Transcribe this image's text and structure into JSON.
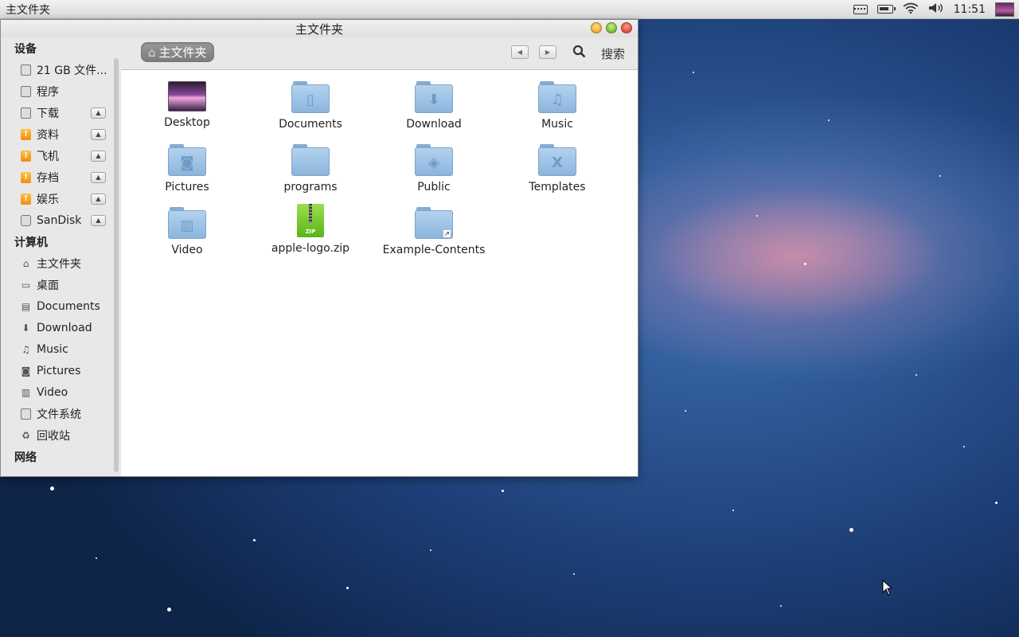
{
  "topbar": {
    "app_title": "主文件夹",
    "clock": "11:51",
    "icons": [
      "keyboard-icon",
      "battery-icon",
      "wifi-icon",
      "volume-icon",
      "user-avatar"
    ]
  },
  "window": {
    "title": "主文件夹",
    "buttons": [
      "minimize",
      "maximize",
      "close"
    ]
  },
  "sidebar": {
    "devices_header": "设备",
    "devices": [
      {
        "label": "21 GB 文件...",
        "icon": "drive-icon",
        "eject": false
      },
      {
        "label": "程序",
        "icon": "drive-icon",
        "eject": false
      },
      {
        "label": "下载",
        "icon": "drive-icon",
        "eject": true
      },
      {
        "label": "资料",
        "icon": "orange-drive-icon",
        "eject": true
      },
      {
        "label": "飞机",
        "icon": "orange-drive-icon",
        "eject": true
      },
      {
        "label": "存档",
        "icon": "orange-drive-icon",
        "eject": true
      },
      {
        "label": "娱乐",
        "icon": "orange-drive-icon",
        "eject": true
      },
      {
        "label": "SanDisk",
        "icon": "usb-drive-icon",
        "eject": true
      }
    ],
    "computer_header": "计算机",
    "computer": [
      {
        "label": "主文件夹",
        "icon": "home-icon"
      },
      {
        "label": "桌面",
        "icon": "desktop-icon"
      },
      {
        "label": "Documents",
        "icon": "documents-icon"
      },
      {
        "label": "Download",
        "icon": "download-icon"
      },
      {
        "label": "Music",
        "icon": "music-icon"
      },
      {
        "label": "Pictures",
        "icon": "camera-icon"
      },
      {
        "label": "Video",
        "icon": "film-icon"
      },
      {
        "label": "文件系统",
        "icon": "drive-icon"
      },
      {
        "label": "回收站",
        "icon": "trash-icon"
      }
    ],
    "network_header": "网络"
  },
  "toolbar": {
    "breadcrumb": "主文件夹",
    "search_label": "搜索"
  },
  "files": [
    {
      "name": "Desktop",
      "kind": "desktop-thumb"
    },
    {
      "name": "Documents",
      "kind": "folder",
      "emblem": "document"
    },
    {
      "name": "Download",
      "kind": "folder",
      "emblem": "download"
    },
    {
      "name": "Music",
      "kind": "folder",
      "emblem": "music"
    },
    {
      "name": "Pictures",
      "kind": "folder",
      "emblem": "camera"
    },
    {
      "name": "programs",
      "kind": "folder",
      "emblem": ""
    },
    {
      "name": "Public",
      "kind": "folder",
      "emblem": "public"
    },
    {
      "name": "Templates",
      "kind": "folder",
      "emblem": "templates"
    },
    {
      "name": "Video",
      "kind": "folder",
      "emblem": "film"
    },
    {
      "name": "apple-logo.zip",
      "kind": "zip"
    },
    {
      "name": "Example-Contents",
      "kind": "folder-link",
      "emblem": ""
    }
  ],
  "zip_badge": "ZIP"
}
